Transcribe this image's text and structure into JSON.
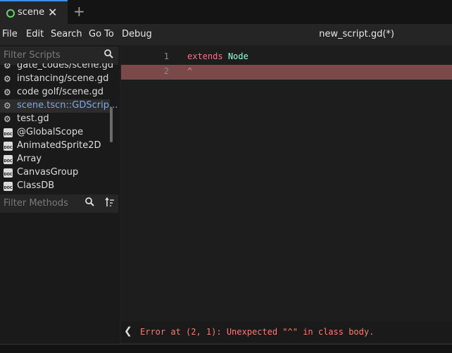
{
  "tab": {
    "label": "scene",
    "close": "✕",
    "add": "+"
  },
  "menu": [
    "File",
    "Edit",
    "Search",
    "Go To",
    "Debug"
  ],
  "script_title": "new_script.gd(*)",
  "scripts_filter": {
    "placeholder": "Filter Scripts"
  },
  "scripts": [
    {
      "label": "gate_codes/scene.gd",
      "icon": "gear-icon"
    },
    {
      "label": "instancing/scene.gd",
      "icon": "gear-icon"
    },
    {
      "label": "code golf/scene.gd",
      "icon": "gear-icon"
    },
    {
      "label": "scene.tscn::GDScrip...",
      "icon": "gear-outline-icon",
      "selected": true
    },
    {
      "label": "test.gd",
      "icon": "gear-icon"
    },
    {
      "label": "@GlobalScope",
      "icon": "doc-icon"
    },
    {
      "label": "AnimatedSprite2D",
      "icon": "doc-icon"
    },
    {
      "label": "Array",
      "icon": "doc-icon"
    },
    {
      "label": "CanvasGroup",
      "icon": "doc-icon"
    },
    {
      "label": "ClassDB",
      "icon": "doc-icon"
    }
  ],
  "doc_icon_text": "DOC",
  "methods_filter": {
    "placeholder": "Filter Methods"
  },
  "code": {
    "line1": {
      "num": "1",
      "kw": "extends",
      "sp": " ",
      "type": "Node"
    },
    "line2": {
      "num": "2",
      "text": "^"
    }
  },
  "status": {
    "arrow": "❮",
    "message": "Error at (2, 1): Unexpected \"^\" in class body."
  }
}
